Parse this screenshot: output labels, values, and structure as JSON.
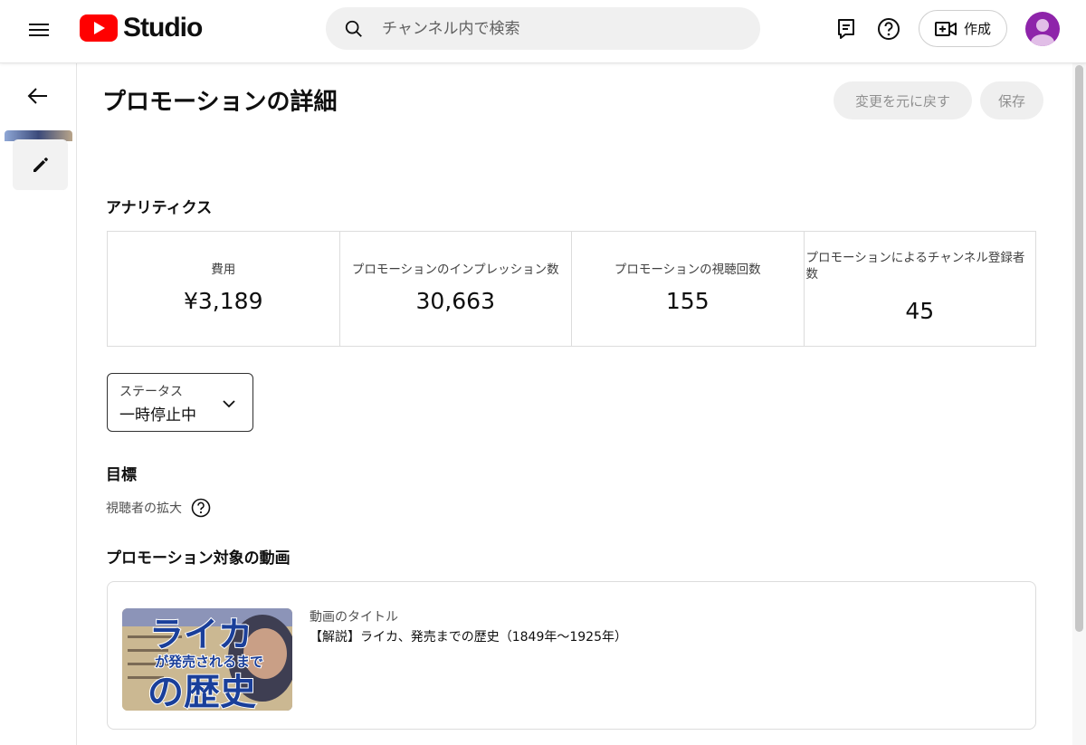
{
  "topbar": {
    "logo_text": "Studio",
    "search_placeholder": "チャンネル内で検索",
    "create_label": "作成"
  },
  "page": {
    "title": "プロモーションの詳細",
    "undo_label": "変更を元に戻す",
    "save_label": "保存"
  },
  "analytics": {
    "heading": "アナリティクス",
    "stats": [
      {
        "label": "費用",
        "value": "¥3,189"
      },
      {
        "label": "プロモーションのインプレッション数",
        "value": "30,663"
      },
      {
        "label": "プロモーションの視聴回数",
        "value": "155"
      },
      {
        "label": "プロモーションによるチャンネル登録者数",
        "value": "45"
      }
    ]
  },
  "status": {
    "caption": "ステータス",
    "value": "一時停止中"
  },
  "goal": {
    "heading": "目標",
    "value": "視聴者の拡大"
  },
  "video": {
    "heading": "プロモーション対象の動画",
    "caption": "動画のタイトル",
    "title": "【解説】ライカ、発売までの歴史（1849年〜1925年）",
    "thumb_line1": "ライカ",
    "thumb_line2": "が発売されるまで",
    "thumb_line3": "の歴史"
  },
  "colors": {
    "brand_red": "#ff0000",
    "avatar": "#8e24aa"
  }
}
